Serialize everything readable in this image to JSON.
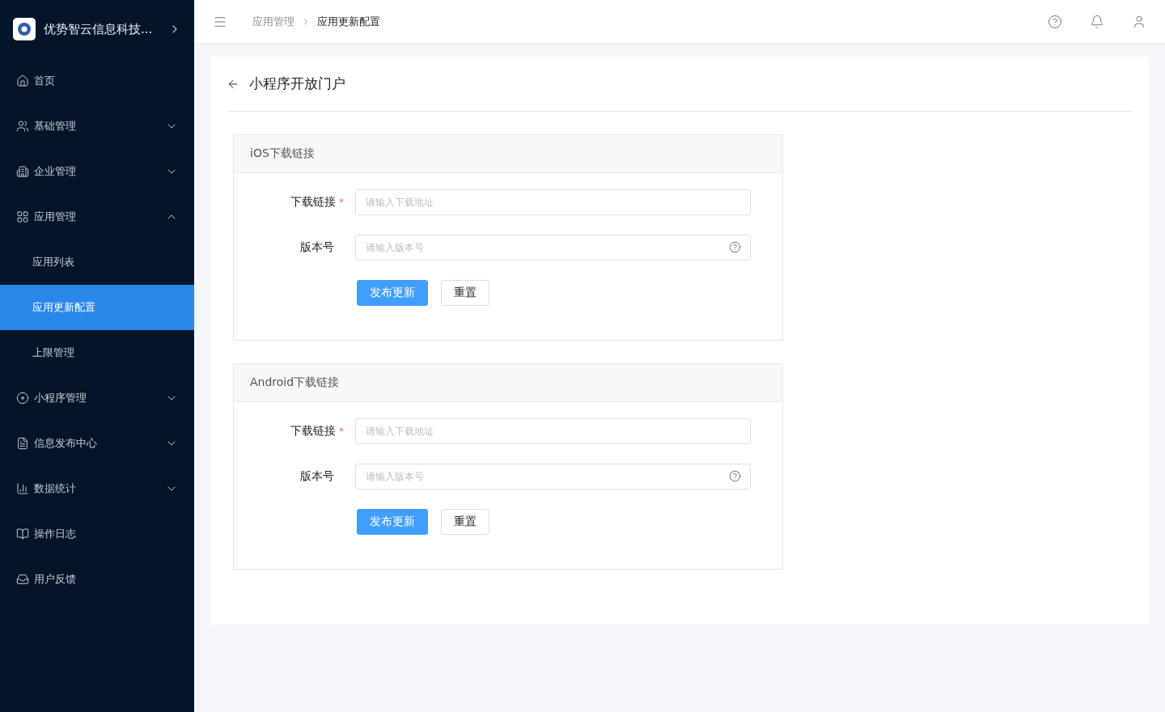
{
  "sidebar": {
    "brand": "优势智云信息科技...",
    "items": [
      {
        "kind": "link",
        "label": "首页"
      },
      {
        "kind": "group",
        "label": "基础管理",
        "expanded": false
      },
      {
        "kind": "group",
        "label": "企业管理",
        "expanded": false
      },
      {
        "kind": "group",
        "label": "应用管理",
        "expanded": true,
        "children": [
          {
            "label": "应用列表",
            "selected": false
          },
          {
            "label": "应用更新配置",
            "selected": true
          },
          {
            "label": "上限管理",
            "selected": false
          }
        ]
      },
      {
        "kind": "group",
        "label": "小程序管理",
        "expanded": false
      },
      {
        "kind": "group",
        "label": "信息发布中心",
        "expanded": false
      },
      {
        "kind": "group",
        "label": "数据统计",
        "expanded": false
      },
      {
        "kind": "link",
        "label": "操作日志"
      },
      {
        "kind": "link",
        "label": "用户反馈"
      }
    ]
  },
  "breadcrumb": [
    "应用管理",
    "应用更新配置"
  ],
  "page": {
    "title": "小程序开放门户",
    "sections": [
      {
        "title": "iOS下载链接",
        "fields": [
          {
            "label": "下载链接",
            "required_mark": "*",
            "placeholder": "请输入下载地址"
          },
          {
            "label": "版本号",
            "placeholder": "请输入版本号",
            "help": true
          }
        ],
        "buttons": [
          {
            "label": "发布更新",
            "kind": "primary"
          },
          {
            "label": "重置",
            "kind": "default"
          }
        ]
      },
      {
        "title": "Android下载链接",
        "fields": [
          {
            "label": "下载链接",
            "required_mark": "*",
            "placeholder": "请输入下载地址"
          },
          {
            "label": "版本号",
            "placeholder": "请输入版本号",
            "help": true
          }
        ],
        "buttons": [
          {
            "label": "发布更新",
            "kind": "primary"
          },
          {
            "label": "重置",
            "kind": "default"
          }
        ]
      }
    ]
  }
}
